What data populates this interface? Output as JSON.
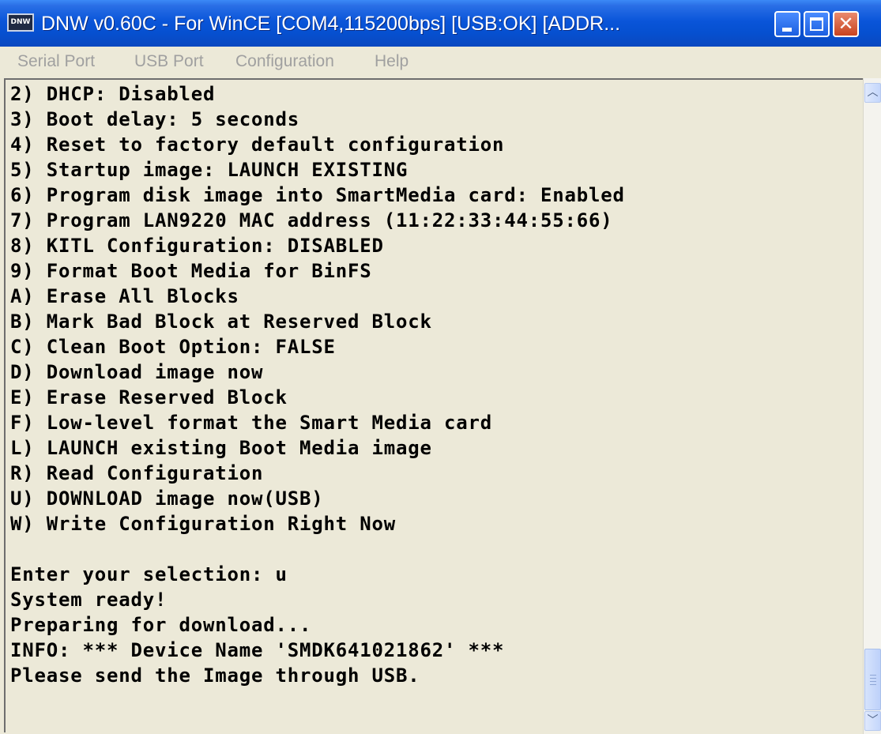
{
  "window": {
    "icon_label": "DNW",
    "title": "DNW v0.60C - For WinCE   [COM4,115200bps] [USB:OK] [ADDR..."
  },
  "menu": [
    "Serial Port",
    "USB Port",
    "Configuration",
    "Help"
  ],
  "terminal": {
    "lines": [
      "2) DHCP: Disabled",
      "3) Boot delay: 5 seconds",
      "4) Reset to factory default configuration",
      "5) Startup image: LAUNCH EXISTING",
      "6) Program disk image into SmartMedia card: Enabled",
      "7) Program LAN9220 MAC address (11:22:33:44:55:66)",
      "8) KITL Configuration: DISABLED",
      "9) Format Boot Media for BinFS",
      "A) Erase All Blocks",
      "B) Mark Bad Block at Reserved Block",
      "C) Clean Boot Option: FALSE",
      "D) Download image now",
      "E) Erase Reserved Block",
      "F) Low-level format the Smart Media card",
      "L) LAUNCH existing Boot Media image",
      "R) Read Configuration",
      "U) DOWNLOAD image now(USB)",
      "W) Write Configuration Right Now",
      "",
      "Enter your selection: u",
      "System ready!",
      "Preparing for download...",
      "INFO: *** Device Name 'SMDK641021862' ***",
      "Please send the Image through USB."
    ]
  },
  "scrollbar": {
    "up_icon": "scroll-up-arrow-icon",
    "down_icon": "scroll-down-arrow-icon",
    "position": 1.0
  }
}
